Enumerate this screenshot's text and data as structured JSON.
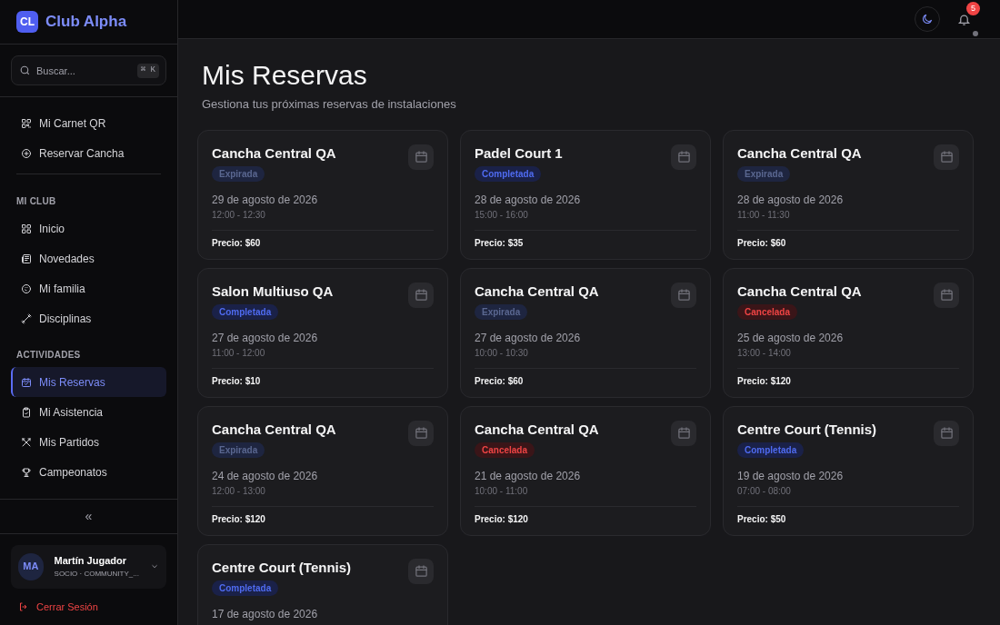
{
  "brand": {
    "initials": "CL",
    "name": "Club Alpha"
  },
  "search": {
    "placeholder": "Buscar...",
    "shortcut": "⌘ K"
  },
  "quick_links": [
    {
      "label": "Mi Carnet QR",
      "selected": false
    },
    {
      "label": "Reservar Cancha",
      "selected": false
    }
  ],
  "sections": [
    {
      "title": "MI CLUB",
      "items": [
        {
          "label": "Inicio",
          "selected": false
        },
        {
          "label": "Novedades",
          "selected": false
        },
        {
          "label": "Mi familia",
          "selected": false
        },
        {
          "label": "Disciplinas",
          "selected": false
        }
      ]
    },
    {
      "title": "ACTIVIDADES",
      "items": [
        {
          "label": "Mis Reservas",
          "selected": true
        },
        {
          "label": "Mi Asistencia",
          "selected": false
        },
        {
          "label": "Mis Partidos",
          "selected": false
        },
        {
          "label": "Campeonatos",
          "selected": false
        }
      ]
    }
  ],
  "collapse": "«",
  "user": {
    "initials": "MA",
    "name": "Martín Jugador",
    "role": "SOCIO · COMMUNITY_..."
  },
  "logout": "Cerrar Sesión",
  "header": {
    "notifications": "5"
  },
  "page": {
    "title": "Mis Reservas",
    "subtitle": "Gestiona tus próximas reservas de instalaciones"
  },
  "reservations": [
    {
      "name": "Cancha Central QA",
      "kind": "expired",
      "status": "Expirada",
      "date": "29 de agosto de 2026",
      "time": "12:00 - 12:30",
      "price": "Precio: $60"
    },
    {
      "name": "Padel Court 1",
      "kind": "completed",
      "status": "Completada",
      "date": "28 de agosto de 2026",
      "time": "15:00 - 16:00",
      "price": "Precio: $35"
    },
    {
      "name": "Cancha Central QA",
      "kind": "expired",
      "status": "Expirada",
      "date": "28 de agosto de 2026",
      "time": "11:00 - 11:30",
      "price": "Precio: $60"
    },
    {
      "name": "Salon Multiuso QA",
      "kind": "completed",
      "status": "Completada",
      "date": "27 de agosto de 2026",
      "time": "11:00 - 12:00",
      "price": "Precio: $10"
    },
    {
      "name": "Cancha Central QA",
      "kind": "expired",
      "status": "Expirada",
      "date": "27 de agosto de 2026",
      "time": "10:00 - 10:30",
      "price": "Precio: $60"
    },
    {
      "name": "Cancha Central QA",
      "kind": "cancelled",
      "status": "Cancelada",
      "date": "25 de agosto de 2026",
      "time": "13:00 - 14:00",
      "price": "Precio: $120"
    },
    {
      "name": "Cancha Central QA",
      "kind": "expired",
      "status": "Expirada",
      "date": "24 de agosto de 2026",
      "time": "12:00 - 13:00",
      "price": "Precio: $120"
    },
    {
      "name": "Cancha Central QA",
      "kind": "cancelled",
      "status": "Cancelada",
      "date": "21 de agosto de 2026",
      "time": "10:00 - 11:00",
      "price": "Precio: $120"
    },
    {
      "name": "Centre Court (Tennis)",
      "kind": "completed",
      "status": "Completada",
      "date": "19 de agosto de 2026",
      "time": "07:00 - 08:00",
      "price": "Precio: $50"
    },
    {
      "name": "Centre Court (Tennis)",
      "kind": "completed",
      "status": "Completada",
      "date": "17 de agosto de 2026"
    }
  ]
}
